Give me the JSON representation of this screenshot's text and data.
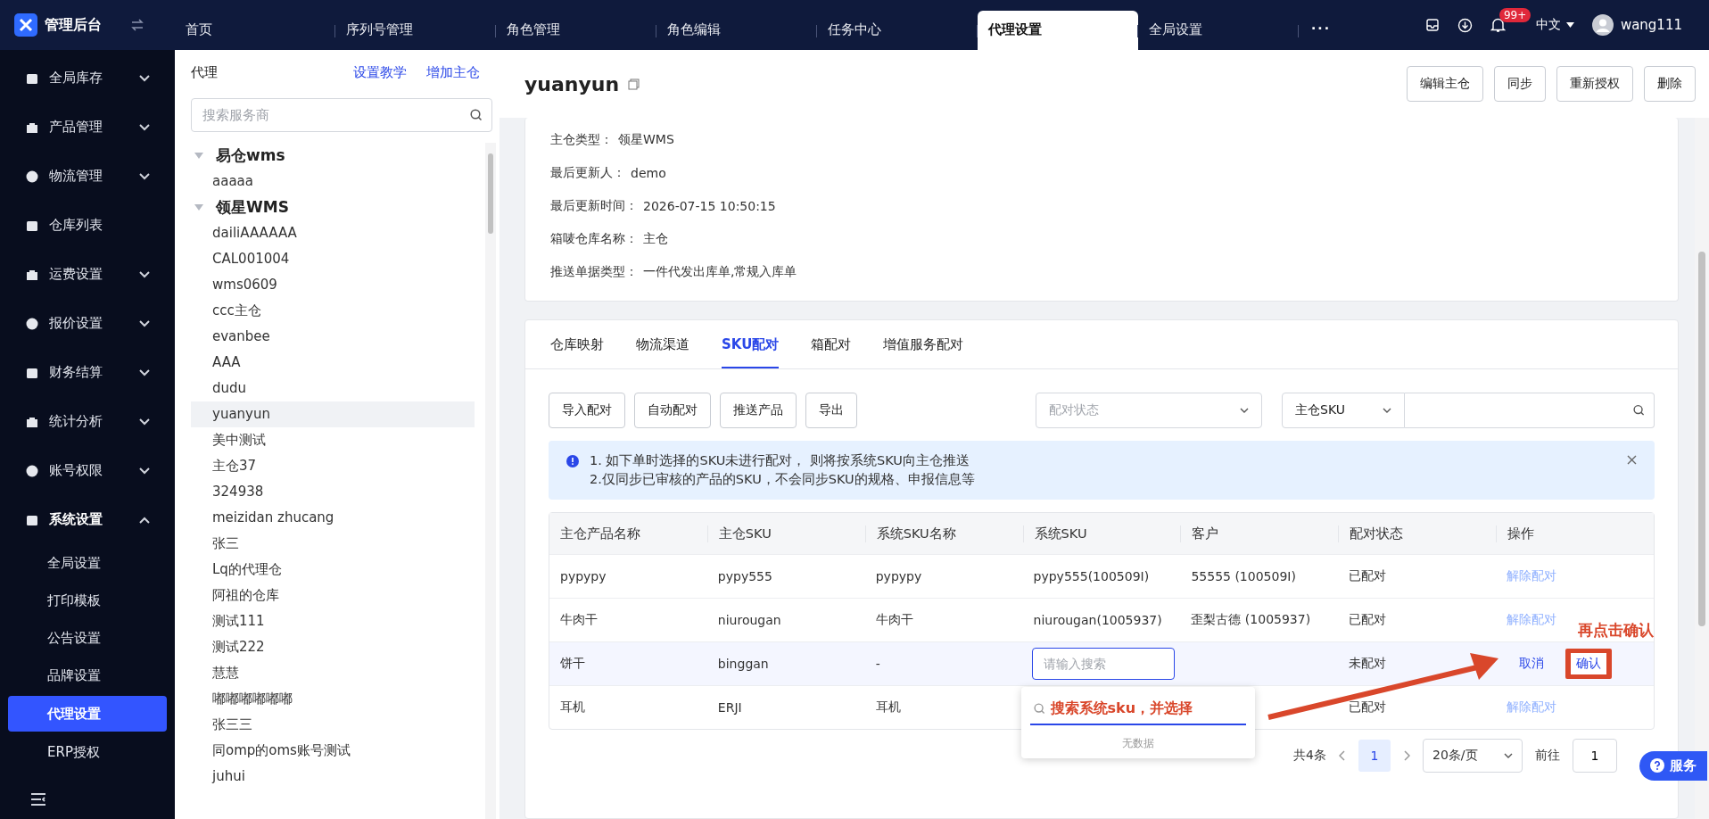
{
  "app": {
    "title": "管理后台"
  },
  "top_tabs": [
    {
      "label": "首页",
      "selected": false
    },
    {
      "label": "序列号管理",
      "selected": false
    },
    {
      "label": "角色管理",
      "selected": false
    },
    {
      "label": "角色编辑",
      "selected": false
    },
    {
      "label": "任务中心",
      "selected": false
    },
    {
      "label": "代理设置",
      "selected": true
    },
    {
      "label": "全局设置",
      "selected": false
    }
  ],
  "top_more": "···",
  "header": {
    "notification_badge": "99+",
    "language": "中文",
    "user": "wang111"
  },
  "sidebar": {
    "items": [
      {
        "label": "全局库存",
        "kind": "group",
        "expanded": false
      },
      {
        "label": "产品管理",
        "kind": "group",
        "expanded": false
      },
      {
        "label": "物流管理",
        "kind": "group",
        "expanded": false
      },
      {
        "label": "仓库列表",
        "kind": "link"
      },
      {
        "label": "运费设置",
        "kind": "group",
        "expanded": false
      },
      {
        "label": "报价设置",
        "kind": "group",
        "expanded": false
      },
      {
        "label": "财务结算",
        "kind": "group",
        "expanded": false
      },
      {
        "label": "统计分析",
        "kind": "group",
        "expanded": false
      },
      {
        "label": "账号权限",
        "kind": "group",
        "expanded": false
      },
      {
        "label": "系统设置",
        "kind": "group",
        "expanded": true,
        "children": [
          {
            "label": "全局设置",
            "selected": false
          },
          {
            "label": "打印模板",
            "selected": false
          },
          {
            "label": "公告设置",
            "selected": false
          },
          {
            "label": "品牌设置",
            "selected": false
          },
          {
            "label": "代理设置",
            "selected": true
          },
          {
            "label": "ERP授权",
            "selected": false
          }
        ]
      }
    ]
  },
  "agents": {
    "title": "代理",
    "links": [
      "设置教学",
      "增加主仓"
    ],
    "search": {
      "placeholder": "搜索服务商"
    },
    "tree": [
      {
        "label": "易仓wms",
        "expanded": true,
        "children": [
          {
            "label": "aaaaa",
            "selected": false
          }
        ]
      },
      {
        "label": "领星WMS",
        "expanded": true,
        "children": [
          {
            "label": "dailiAAAAAA",
            "selected": false
          },
          {
            "label": "CAL001004",
            "selected": false
          },
          {
            "label": "wms0609",
            "selected": false
          },
          {
            "label": "ccc主仓",
            "selected": false
          },
          {
            "label": "evanbee",
            "selected": false
          },
          {
            "label": "AAA",
            "selected": false
          },
          {
            "label": "dudu",
            "selected": false
          },
          {
            "label": "yuanyun",
            "selected": true
          },
          {
            "label": "美中测试",
            "selected": false
          },
          {
            "label": "主仓37",
            "selected": false
          },
          {
            "label": "324938",
            "selected": false
          },
          {
            "label": "meizidan zhucang",
            "selected": false
          },
          {
            "label": "张三",
            "selected": false
          },
          {
            "label": "Lq的代理仓",
            "selected": false
          },
          {
            "label": "阿祖的仓库",
            "selected": false
          },
          {
            "label": "测试111",
            "selected": false
          },
          {
            "label": "测试222",
            "selected": false
          },
          {
            "label": "慧慧",
            "selected": false
          },
          {
            "label": "嘟嘟嘟嘟嘟嘟",
            "selected": false
          },
          {
            "label": "张三三",
            "selected": false
          },
          {
            "label": "同omp的oms账号测试",
            "selected": false
          },
          {
            "label": "juhui",
            "selected": false
          }
        ]
      }
    ]
  },
  "detail": {
    "title": "yuanyun",
    "buttons": [
      "编辑主仓",
      "同步",
      "重新授权",
      "删除"
    ],
    "info": [
      {
        "label": "主仓类型：",
        "value": "领星WMS"
      },
      {
        "label": "最后更新人：",
        "value": "demo"
      },
      {
        "label": "最后更新时间：",
        "value": "2026-07-15 10:50:15"
      },
      {
        "label": "箱唛仓库名称：",
        "value": "主仓"
      },
      {
        "label": "推送单据类型：",
        "value": "一件代发出库单,常规入库单"
      }
    ]
  },
  "tabs": [
    {
      "label": "仓库映射",
      "selected": false
    },
    {
      "label": "物流渠道",
      "selected": false
    },
    {
      "label": "SKU配对",
      "selected": true
    },
    {
      "label": "箱配对",
      "selected": false
    },
    {
      "label": "增值服务配对",
      "selected": false
    }
  ],
  "toolbar": {
    "buttons": [
      "导入配对",
      "自动配对",
      "推送产品",
      "导出"
    ],
    "status_filter": {
      "placeholder": "配对状态"
    },
    "field_select": "主仓SKU"
  },
  "alert": {
    "lines": [
      "1. 如下单时选择的SKU未进行配对， 则将按系统SKU向主仓推送",
      "2.仅同步已审核的产品的SKU，不会同步SKU的规格、申报信息等"
    ]
  },
  "table": {
    "columns": [
      "主仓产品名称",
      "主仓SKU",
      "系统SKU名称",
      "系统SKU",
      "客户",
      "配对状态",
      "操作"
    ],
    "rows": [
      {
        "editing": false,
        "cells": [
          "pypypy",
          "pypy555",
          "pypypy",
          "pypy555(100509I)",
          "55555 (100509I)",
          "已配对"
        ],
        "actions": [
          "解除配对"
        ]
      },
      {
        "editing": false,
        "cells": [
          "牛肉干",
          "niurougan",
          "牛肉干",
          "niurougan(1005937)",
          "歪梨古德 (1005937)",
          "已配对"
        ],
        "actions": [
          "解除配对"
        ]
      },
      {
        "editing": true,
        "cells": [
          "饼干",
          "binggan",
          "-",
          "",
          "",
          "未配对"
        ],
        "placeholder": "请输入搜索",
        "actions": [
          "取消",
          "确认"
        ]
      },
      {
        "editing": false,
        "cells": [
          "耳机",
          "ERJI",
          "耳机",
          "",
          "",
          "已配对"
        ],
        "actions": [
          "解除配对"
        ]
      }
    ]
  },
  "dropdown": {
    "value": "搜索系统sku，并选择",
    "empty": "无数据"
  },
  "pagination": {
    "total": "共4条",
    "pages": [
      {
        "label": "1",
        "selected": true
      }
    ],
    "page_size": "20条/页",
    "goto_label": "前往",
    "goto_value": "1"
  },
  "service_button": "服务",
  "annotation": {
    "label": "再点击确认"
  }
}
